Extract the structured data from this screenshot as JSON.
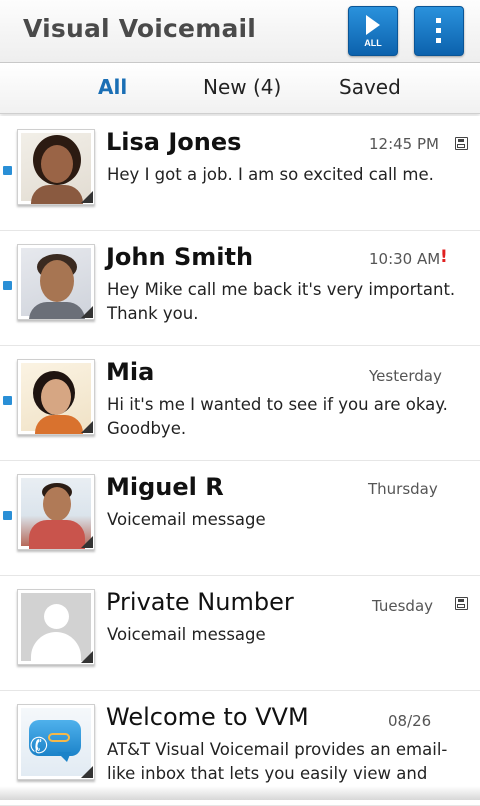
{
  "header": {
    "title": "Visual Voicemail",
    "play_all_label": "ALL",
    "play_all_icon": "play-icon",
    "menu_icon": "overflow-menu-icon",
    "accent": "#1a6fb5"
  },
  "tabs": [
    {
      "label": "All",
      "selected": true
    },
    {
      "label": "New (4)",
      "selected": false
    },
    {
      "label": "Saved",
      "selected": false
    }
  ],
  "messages": [
    {
      "name": "Lisa Jones",
      "time": "12:45 PM",
      "text": "Hey I got a job. I am so excited call me.",
      "unread": true,
      "saved": true,
      "urgent": false
    },
    {
      "name": "John Smith",
      "time": "10:30 AM",
      "urgent_mark": "!",
      "text": "Hey Mike call me back it's very important. Thank you.",
      "unread": true,
      "saved": false,
      "urgent": true
    },
    {
      "name": "Mia",
      "time": "Yesterday",
      "text": "Hi it's me I wanted to see if you are okay. Goodbye.",
      "unread": true,
      "saved": false,
      "urgent": false
    },
    {
      "name": "Miguel R",
      "time": "Thursday",
      "text": "Voicemail message",
      "unread": true,
      "saved": false,
      "urgent": false
    },
    {
      "name": "Private Number",
      "time": "Tuesday",
      "text": "Voicemail message",
      "unread": false,
      "saved": true,
      "urgent": false
    },
    {
      "name": "Welcome to VVM",
      "time": "08/26",
      "text": "AT&T Visual Voicemail provides an email-like inbox that lets you easily view and",
      "unread": false,
      "saved": false,
      "urgent": false
    }
  ],
  "colors": {
    "unread_indicator": "#2a8fd6",
    "urgent": "#e02020",
    "button": "#1a78c6"
  }
}
